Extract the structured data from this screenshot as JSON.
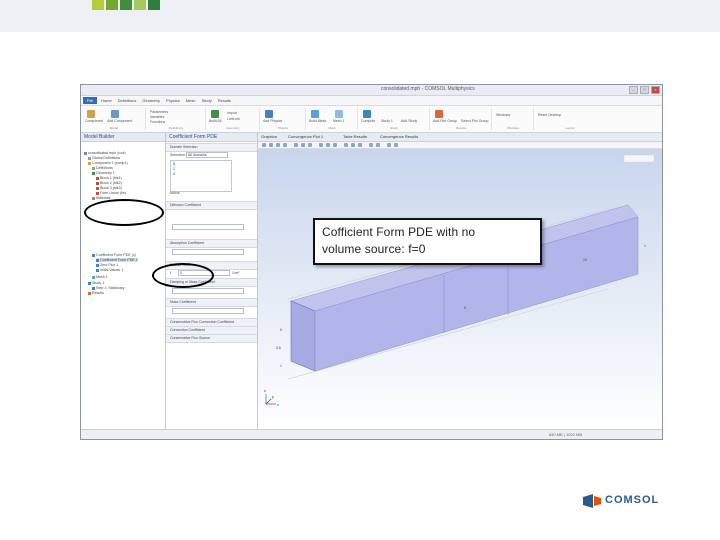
{
  "window": {
    "title": "consolidated.mph - COMSOL Multiphysics",
    "controls": [
      "–",
      "□",
      "×"
    ]
  },
  "menubar": {
    "file": "File",
    "tabs": [
      "Home",
      "Definitions",
      "Geometry",
      "Physics",
      "Mesh",
      "Study",
      "Results"
    ]
  },
  "ribbon": {
    "groups": [
      "Model",
      "Definitions",
      "Geometry",
      "Physics",
      "Mesh",
      "Study",
      "Results",
      "Windows",
      "Layout"
    ],
    "buttons": [
      "Component",
      "Add Component",
      "Parameters",
      "Variables",
      "Functions",
      "Build All",
      "Import",
      "LiveLink",
      "Add Physics",
      "Build Mesh",
      "Mesh 1",
      "Compute",
      "Study 1",
      "Add Study",
      "Add Plot Group",
      "Select Plot Group",
      "Windows",
      "Reset Desktop"
    ]
  },
  "model_builder": {
    "title": "Model Builder",
    "tree": [
      "consolidated.mph (root)",
      "Global Definitions",
      "Component 1 (comp1)",
      "Definitions",
      "Geometry 1",
      "Block 1 (blk1)",
      "Block 2 (blk2)",
      "Block 3 (blk3)",
      "Form Union (fin)",
      "Materials",
      "Coefficient Form PDE (c)",
      "Coefficient Form PDE 1",
      "Zero Flux 1",
      "Initial Values 1",
      "Mesh 1",
      "Study 1",
      "Step 1: Stationary",
      "Results"
    ]
  },
  "settings": {
    "title": "Coefficient Form PDE",
    "sections": [
      "Domain Selection",
      "Diffusion Coefficient",
      "Absorption Coefficient",
      "Source Term",
      "Damping or Mass Coefficient",
      "Mass Coefficient",
      "Conservative Flux Convection Coefficient",
      "Convection Coefficient",
      "Conservative Flux Source"
    ],
    "selection_label": "Selection:",
    "selection_value": "All domains",
    "domain_list": [
      "1",
      "2",
      "3"
    ],
    "active_label": "Active",
    "source_field": "f",
    "source_value": "0",
    "units": "1/m²"
  },
  "graphics": {
    "tabs": [
      "Graphics",
      "Convergence Plot 1",
      "Table Results",
      "Convergence Results"
    ],
    "status": "840 MB | 1022 MB",
    "axis_labels": [
      "x",
      "y",
      "z"
    ],
    "tick_labels": [
      "0",
      "0.5",
      "1",
      "5",
      "10",
      "1"
    ]
  },
  "callout": {
    "line1": "Cofficient Form PDE with no",
    "line2": "volume source: f=0"
  },
  "brand": {
    "name": "COMSOL",
    "color": "#2c5a8c",
    "accent": "#e65100"
  }
}
